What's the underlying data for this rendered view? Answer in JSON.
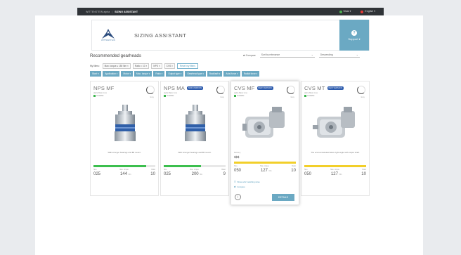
{
  "topbar": {
    "crumb_home": "WITTENSTEIN alpha",
    "crumb_separator": "|",
    "crumb_current": "SIZING ASSISTANT",
    "user_label": "Wala",
    "language_label": "English",
    "user_dot_color": "#4caf50",
    "language_dot_color": "#e53935",
    "caret_icon": "chevron-down-icon"
  },
  "header": {
    "logo_tag": "WITTENSTEIN",
    "title": "SIZING ASSISTANT",
    "support_icon_glyph": "?",
    "support_label": "Support"
  },
  "section": {
    "title": "Recommended gearheads",
    "compare_label": "Compare",
    "sort_label": "Sort by relevance",
    "order_label": "Descending",
    "caret_glyph": "⌄"
  },
  "filters": {
    "label": "My filters:",
    "tags": [
      "Max. torque ≥ 150 Nm",
      "Ratio = 10",
      "NPS",
      "CVS"
    ],
    "remove_glyph": "×",
    "reset_label": "Reset my filters"
  },
  "toolbar": {
    "start_label": "Start",
    "buttons": [
      "Application",
      "Motor",
      "Max. torque",
      "Ratio",
      "Output type",
      "Gearhead type",
      "Backlash",
      "Axial force",
      "Radial force"
    ],
    "dropdown_glyph": "▾"
  },
  "cards": [
    {
      "name": "NPS MF",
      "badge": "",
      "subtitle": "alpha Basic Line",
      "status": "Available",
      "ring_label": "Easy",
      "description": "With stronger bearings and B5 mount.",
      "bar_fraction": 0.85,
      "bar_color": "green",
      "stat_labels": [
        "Size",
        "Max. torque",
        "Ratio"
      ],
      "size": "025",
      "torque": "144",
      "torque_unit": "Nm",
      "ratio": "10"
    },
    {
      "name": "NPS MA",
      "badge": "NEW VERSION",
      "subtitle": "alpha Basic Line",
      "status": "Available",
      "ring_label": "Easy",
      "description": "With stronger bearings and B5 mount.",
      "bar_fraction": 0.6,
      "bar_color": "green",
      "stat_labels": [
        "Size",
        "Max. torque",
        "Ratio"
      ],
      "size": "025",
      "torque": "200",
      "torque_unit": "Nm",
      "ratio": "9"
    },
    {
      "name": "CVS MF",
      "badge": "NEW VERSION",
      "subtitle": "alpha Basic Line",
      "status": "Available",
      "ring_label": "Easy",
      "price_label": "Delivery",
      "price": "$$$",
      "bar_fraction": 1.0,
      "bar_color": "yellow",
      "stat_labels": [
        "Size",
        "Max. torque",
        "Ratio"
      ],
      "size": "050",
      "torque": "127",
      "torque_unit": "Nm",
      "ratio": "10",
      "link1": "Show all 2 matching sizes",
      "link2": "Compare",
      "info_glyph": "i",
      "details_label": "DETAILS"
    },
    {
      "name": "CVS MT",
      "badge": "NEW VERSION",
      "subtitle": "alpha Basic Line",
      "status": "Available",
      "ring_label": "Easy",
      "description": "The economical alternative right angle with output shaft.",
      "bar_fraction": 1.0,
      "bar_color": "yellow",
      "stat_labels": [
        "Size",
        "Max. torque",
        "Ratio"
      ],
      "size": "050",
      "torque": "127",
      "torque_unit": "Nm",
      "ratio": "10"
    }
  ]
}
